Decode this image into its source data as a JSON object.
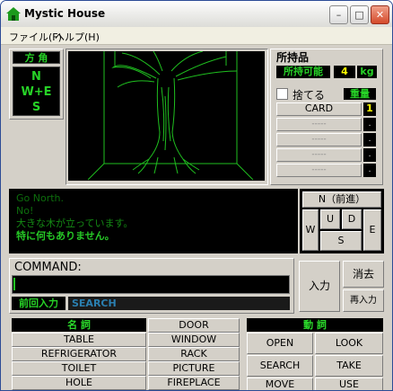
{
  "window": {
    "title": "Mystic House"
  },
  "menu": {
    "file": "ファイル(F)",
    "help": "ヘルプ(H)"
  },
  "direction": {
    "header": "方 角",
    "line1": "N",
    "line2": "W+E",
    "line3": "S"
  },
  "inventory": {
    "header": "所持品",
    "capacity_label": "所持可能",
    "capacity_value": "4",
    "capacity_unit": "kg",
    "discard_label": "捨てる",
    "weight_label": "重量",
    "items": [
      {
        "name": "CARD",
        "count": "1"
      },
      {
        "name": "-----",
        "count": "."
      },
      {
        "name": "-----",
        "count": "."
      },
      {
        "name": "-----",
        "count": "."
      },
      {
        "name": "-----",
        "count": "."
      }
    ]
  },
  "messages": {
    "lines": [
      "Go North.",
      "No!",
      "大きな木が立っています。",
      "特に何もありません。"
    ]
  },
  "movement": {
    "north": "N（前進）",
    "west": "W",
    "up": "U",
    "down": "D",
    "east": "E",
    "south": "S"
  },
  "command": {
    "label": "COMMAND:",
    "value": "",
    "prev_label": "前回入力",
    "search_text": "SEARCH",
    "enter": "入力",
    "clear": "消去",
    "reenter": "再入力"
  },
  "nouns": {
    "header": "名 詞",
    "left": [
      "TABLE",
      "REFRIGERATOR",
      "TOILET",
      "HOLE"
    ],
    "right": [
      "DOOR",
      "WINDOW",
      "RACK",
      "PICTURE",
      "FIREPLACE"
    ]
  },
  "verbs": {
    "header": "動 詞",
    "items": [
      "OPEN",
      "LOOK",
      "SEARCH",
      "TAKE",
      "MOVE",
      "USE"
    ]
  },
  "colors": {
    "lcd_green": "#22c322",
    "bg": "#d4d0c8",
    "scene_lines": "#1fbf1f"
  }
}
